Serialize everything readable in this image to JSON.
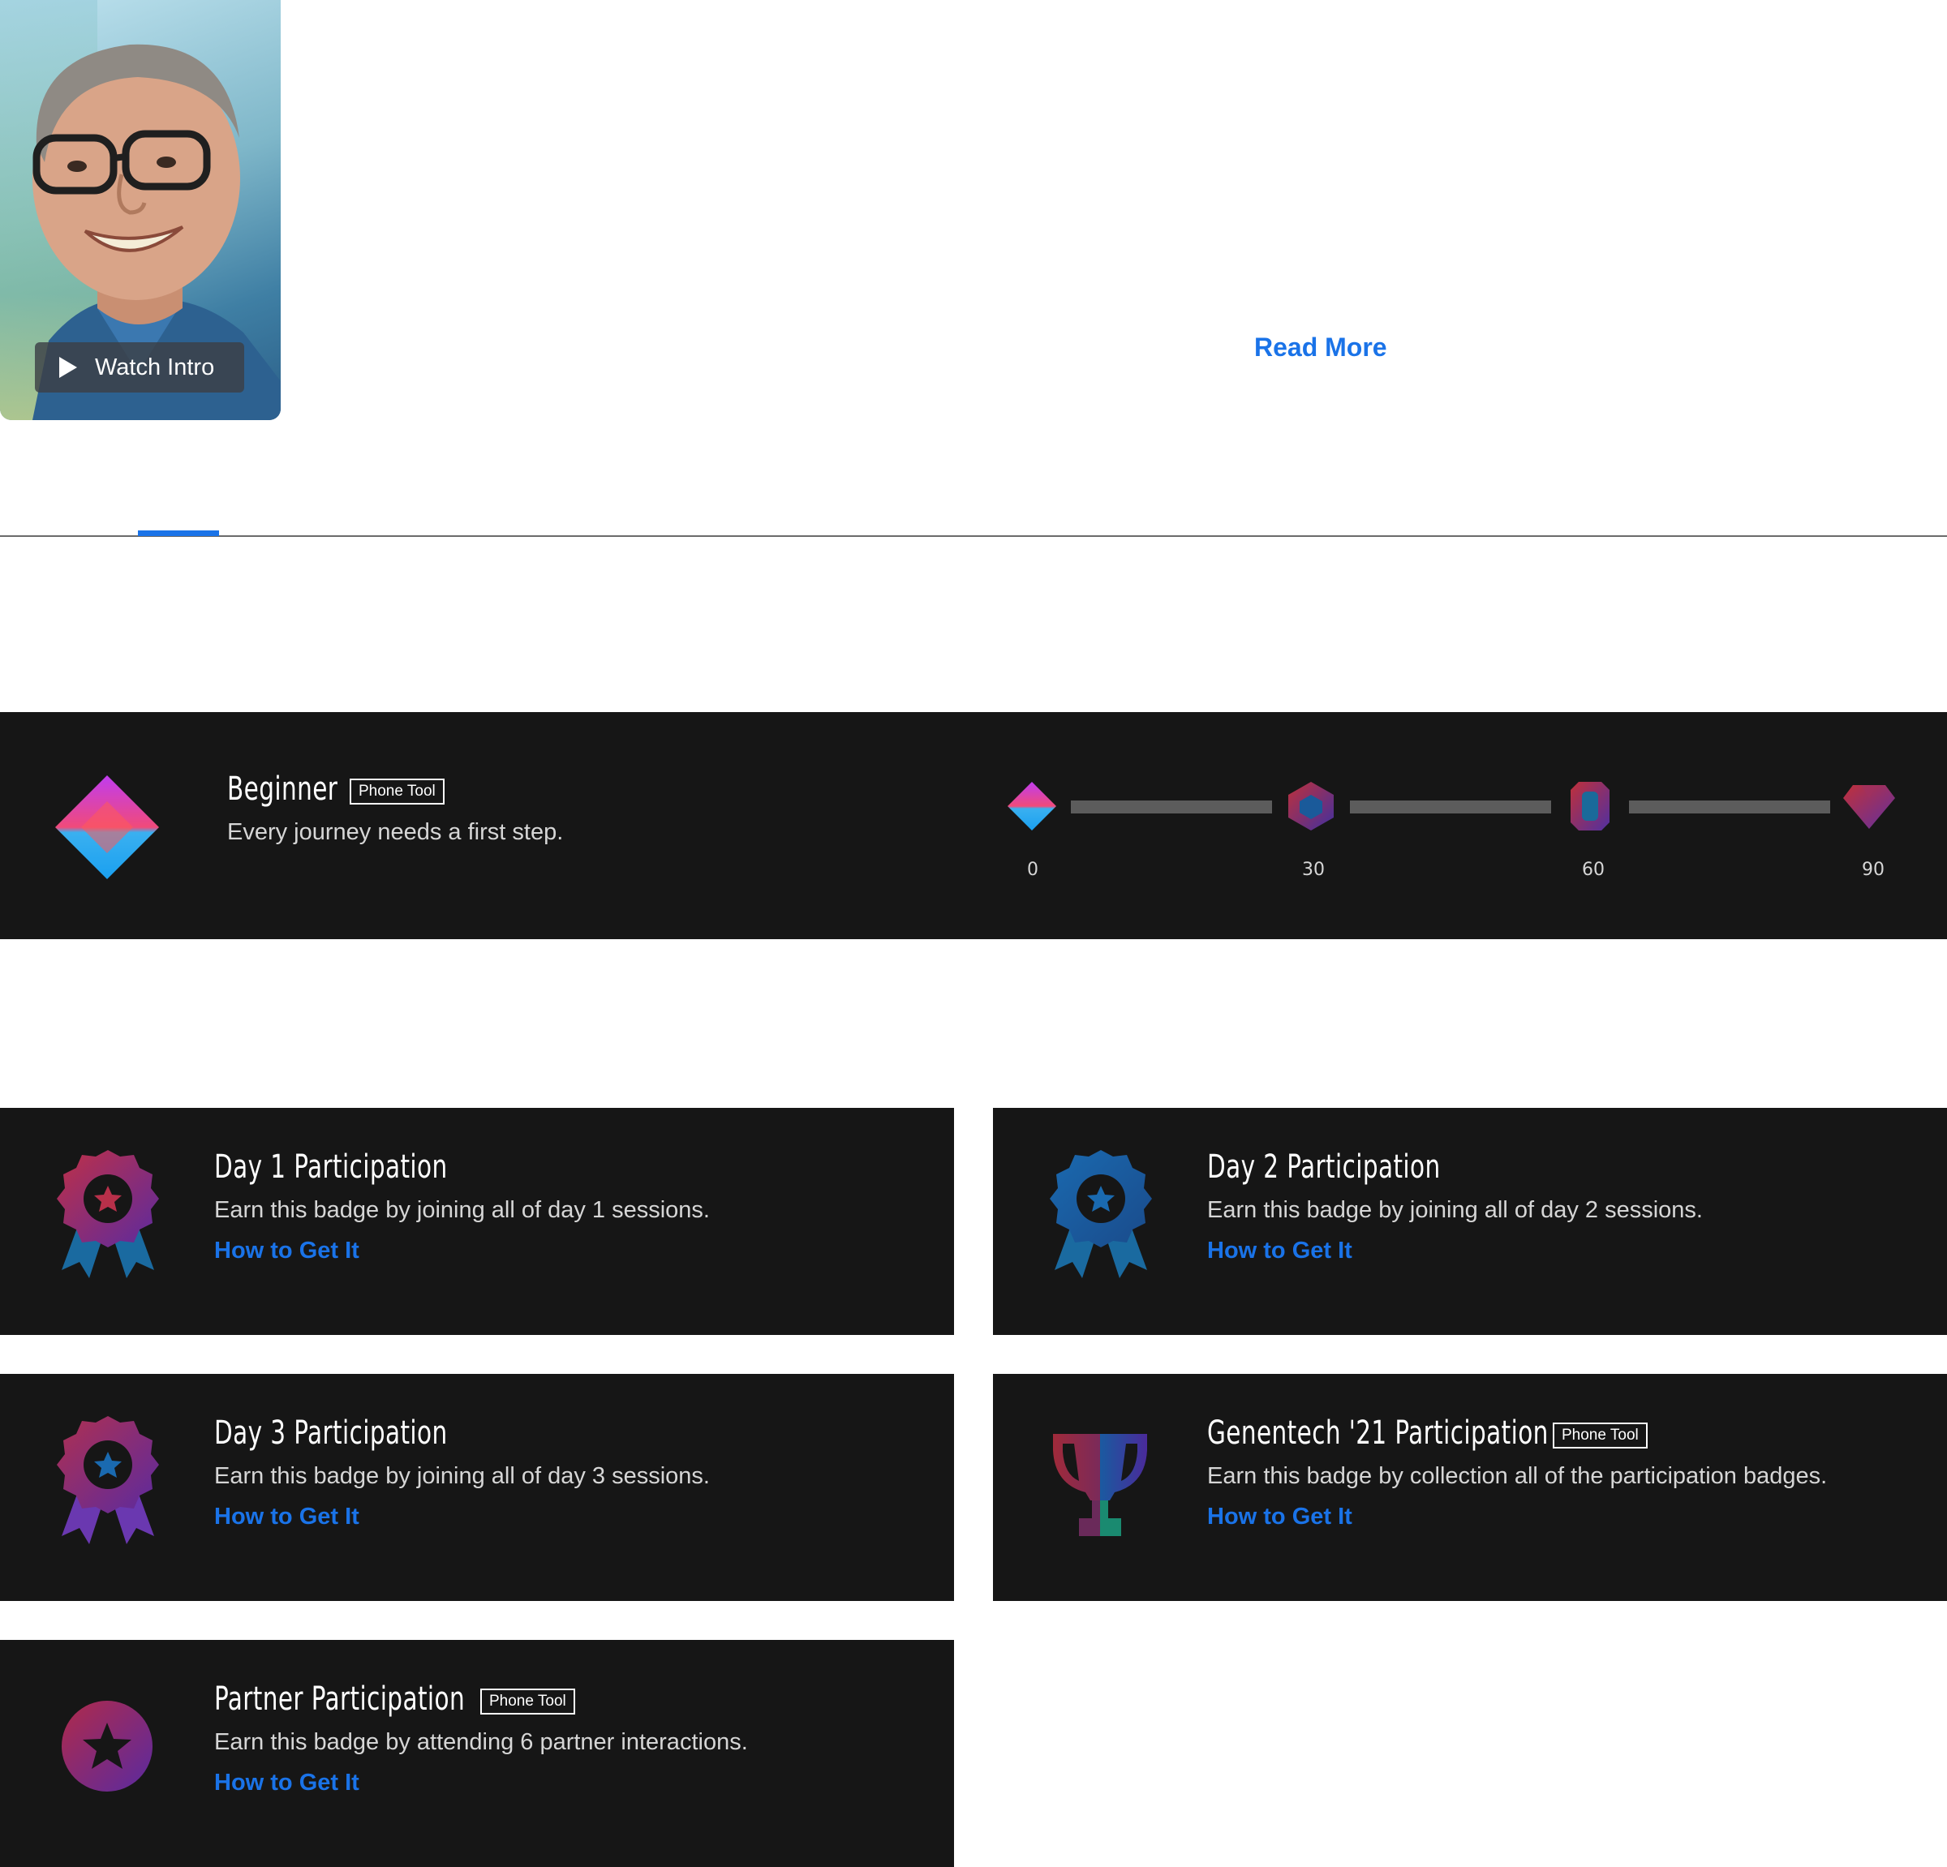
{
  "profile": {
    "watch_intro_label": "Watch Intro"
  },
  "read_more_label": "Read More",
  "level": {
    "title": "Beginner",
    "pill": "Phone Tool",
    "description": "Every journey needs a first step.",
    "milestones": [
      "0",
      "30",
      "60",
      "90"
    ],
    "progress_fraction": 0
  },
  "badges": [
    {
      "title": "Day 1 Participation",
      "pill": "",
      "description": "Earn this badge by joining all of day 1 sessions.",
      "link": "How to Get It",
      "icon": "ribbon-award-icon"
    },
    {
      "title": "Day 2 Participation",
      "pill": "",
      "description": "Earn this badge by joining all of day 2 sessions.",
      "link": "How to Get It",
      "icon": "ribbon-award-icon"
    },
    {
      "title": "Day 3 Participation",
      "pill": "",
      "description": "Earn this badge by joining all of day 3 sessions.",
      "link": "How to Get It",
      "icon": "ribbon-award-icon"
    },
    {
      "title": "Genentech '21 Participation",
      "pill": "Phone Tool",
      "description": "Earn this badge by collection all of the participation badges.",
      "link": "How to Get It",
      "icon": "trophy-icon"
    },
    {
      "title": "Partner Participation",
      "pill": "Phone Tool",
      "description": "Earn this badge by attending 6 partner interactions.",
      "link": "How to Get It",
      "icon": "star-circle-icon"
    }
  ],
  "colors": {
    "accent": "#1a73e8",
    "panel_bg": "#161616",
    "track": "#5c5c5c"
  }
}
